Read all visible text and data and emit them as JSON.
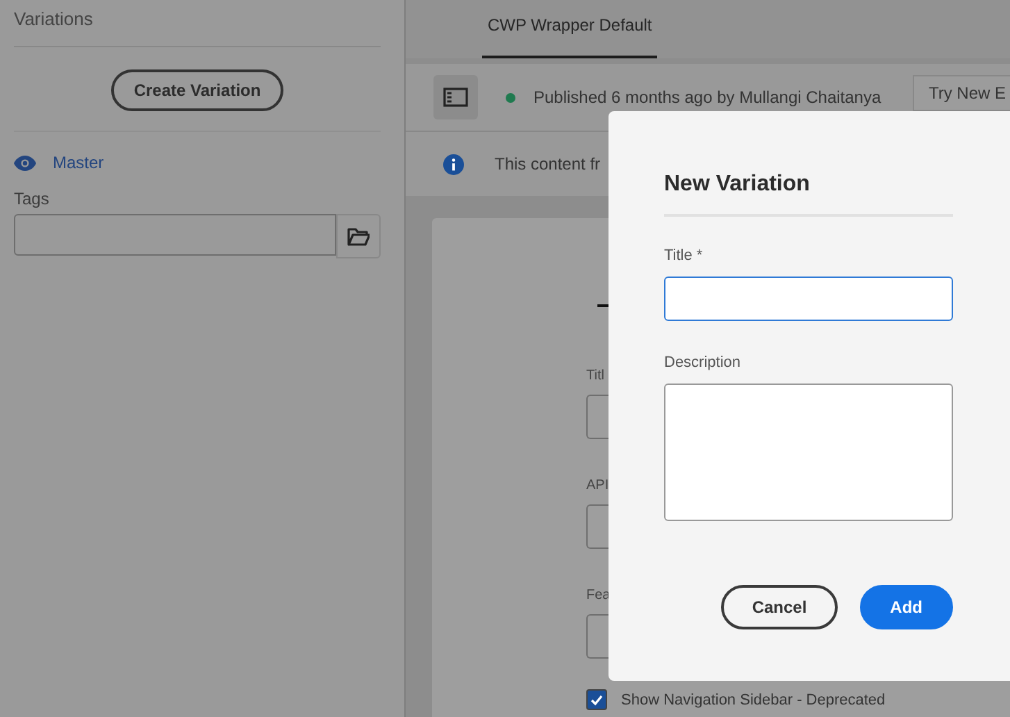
{
  "sidebar": {
    "title": "Variations",
    "create_button": "Create Variation",
    "variation": {
      "label": "Master"
    },
    "tags_label": "Tags"
  },
  "tabs": [
    {
      "label": "CWP Wrapper Default",
      "selected": true
    }
  ],
  "toolbar": {
    "status": "Published 6 months ago by Mullangi Chaitanya",
    "try_button": "Try New E"
  },
  "info": {
    "message": "This content fr"
  },
  "form": {
    "fields": [
      {
        "label": "Titl"
      },
      {
        "label": "API"
      },
      {
        "label": "Fea"
      }
    ],
    "checkbox": {
      "label": "Show Navigation Sidebar - Deprecated",
      "checked": true
    }
  },
  "dialog": {
    "title": "New Variation",
    "fields": [
      {
        "kind": "input",
        "label": "Title *",
        "focused": true
      },
      {
        "kind": "textarea",
        "label": "Description",
        "focused": false
      }
    ],
    "buttons": [
      {
        "label": "Cancel",
        "kind": "secondary"
      },
      {
        "label": "Add",
        "kind": "primary"
      }
    ]
  }
}
